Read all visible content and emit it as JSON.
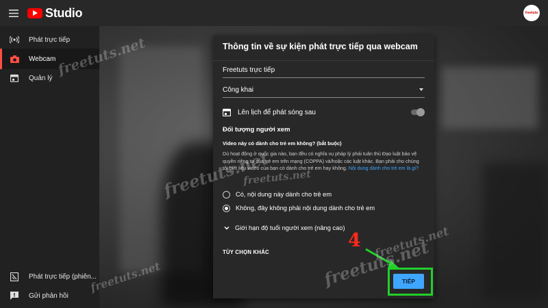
{
  "header": {
    "app_name": "Studio",
    "menu_icon": "hamburger-menu-icon",
    "logo_icon": "youtube-play-icon",
    "avatar_text": "freetuts"
  },
  "sidebar": {
    "items": [
      {
        "label": "Phát trực tiếp",
        "icon": "live-broadcast-icon",
        "active": false
      },
      {
        "label": "Webcam",
        "icon": "camera-icon",
        "active": true
      },
      {
        "label": "Quản lý",
        "icon": "calendar-icon",
        "active": false
      }
    ],
    "bottom_items": [
      {
        "label": "Phát trực tiếp (phiên...",
        "icon": "live-version-icon"
      },
      {
        "label": "Gửi phản hồi",
        "icon": "feedback-icon"
      }
    ]
  },
  "dialog": {
    "title": "Thông tin về sự kiện phát trực tiếp qua webcam",
    "stream_title_value": "Freetuts trực tiếp",
    "privacy_value": "Công khai",
    "schedule_label": "Lên lịch để phát sóng sau",
    "schedule_enabled": false,
    "audience_heading": "Đối tượng người xem",
    "kids_question": "Video này có dành cho trẻ em không? (bắt buộc)",
    "kids_description": "Dù hoạt động ở quốc gia nào, bạn đều có nghĩa vụ pháp lý phải tuân thủ Đạo luật bảo vệ quyền riêng tư của trẻ em trên mạng (COPPA) và/hoặc các luật khác. Bạn phải cho chúng tôi biết liệu video của bạn có dành cho trẻ em hay không.",
    "kids_link": "Nội dung dành cho trẻ em là gì?",
    "radio_options": [
      {
        "label": "Có, nội dung này dành cho trẻ em",
        "checked": false
      },
      {
        "label": "Không, đây không phải nội dung dành cho trẻ em",
        "checked": true
      }
    ],
    "advanced_label": "Giới hạn độ tuổi người xem (nâng cao)",
    "more_options_label": "TÙY CHỌN KHÁC",
    "next_label": "TIẾP"
  },
  "annotation": {
    "step_number": "4",
    "highlight_color": "#22d02a",
    "step_color": "#ff2a1a"
  },
  "watermark": "freetuts.net",
  "colors": {
    "accent_red": "#ff0000",
    "active_bar": "#ff4e45",
    "link_blue": "#3ea6ff",
    "button_blue": "#3ea6ff"
  }
}
